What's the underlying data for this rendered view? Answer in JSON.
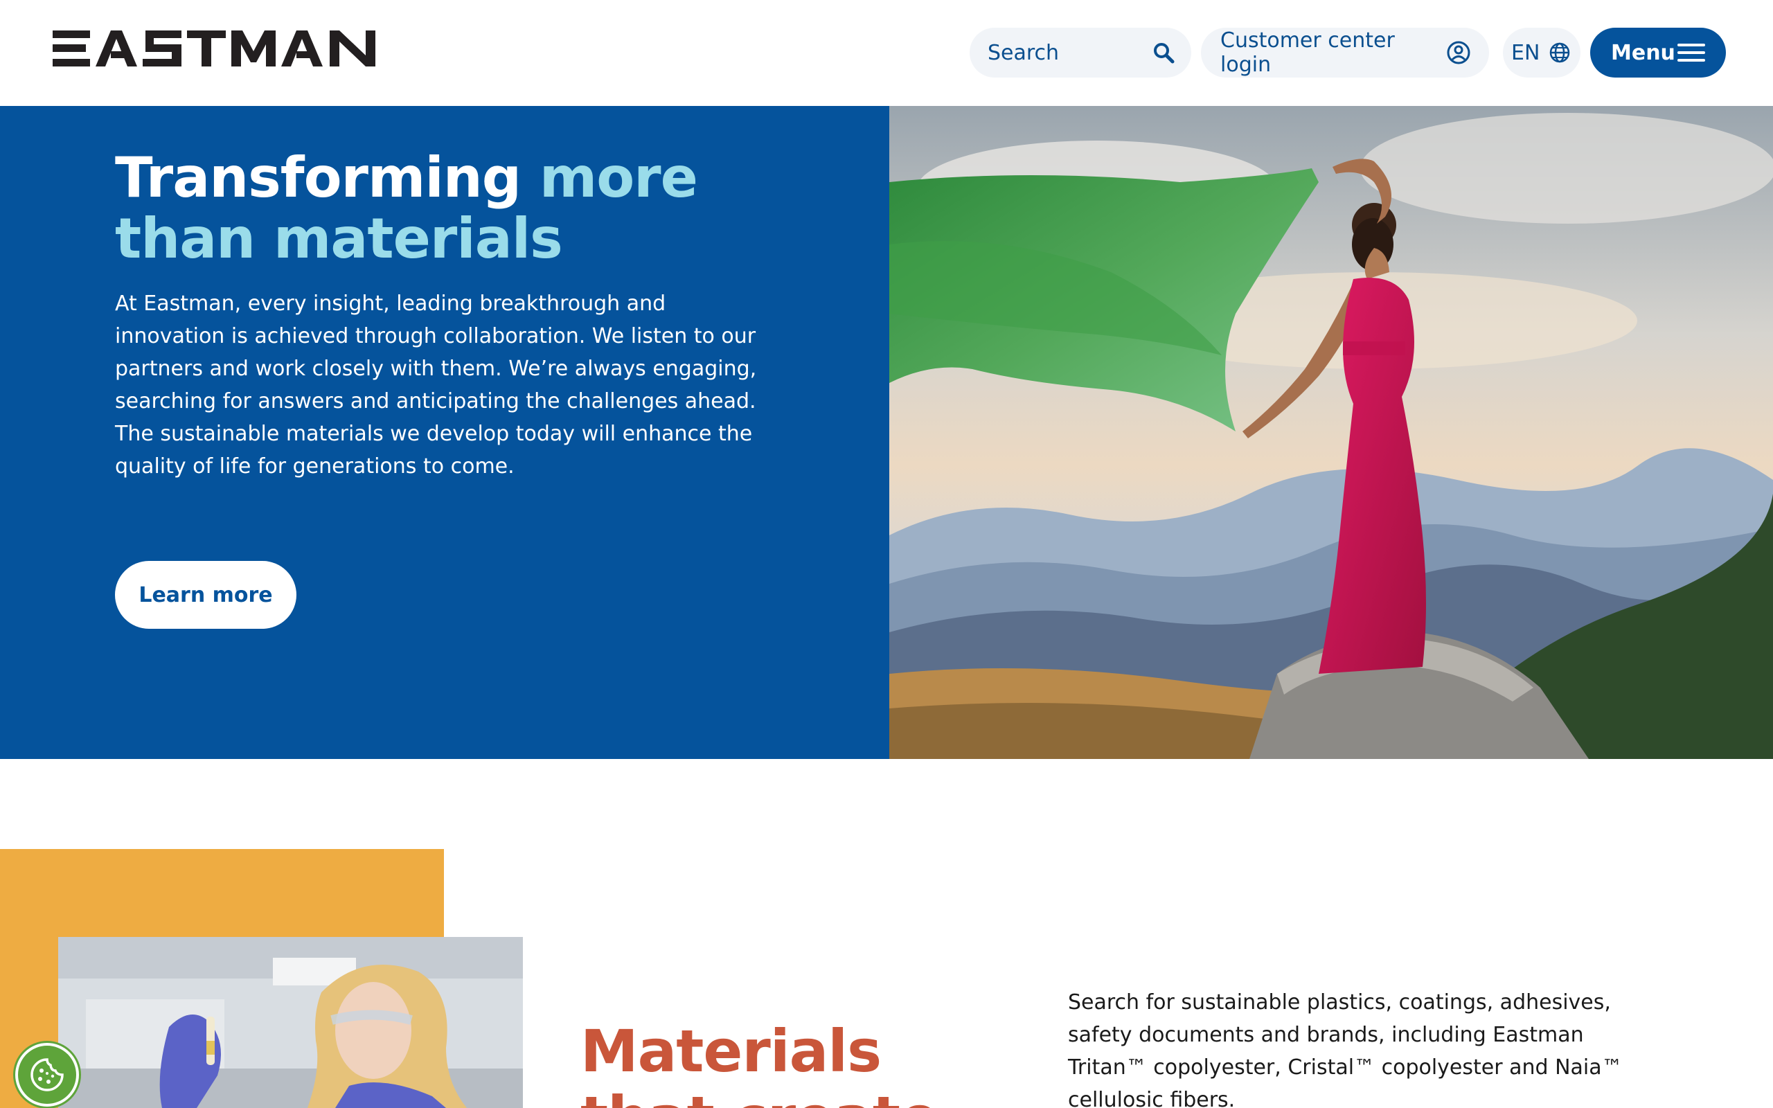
{
  "header": {
    "logo_text": "EASTMAN",
    "search": {
      "placeholder": "Search",
      "icon": "search-icon"
    },
    "login": {
      "label": "Customer center login",
      "icon": "user-circle-icon"
    },
    "language": {
      "label": "EN",
      "icon": "globe-icon"
    },
    "menu": {
      "label": "Menu",
      "icon": "hamburger-icon"
    }
  },
  "hero": {
    "title_white": "Transforming ",
    "title_accent_1": "more",
    "title_accent_2": "than materials",
    "body": "At Eastman, every insight, leading breakthrough and innovation is achieved through collaboration. We listen to our partners and work closely with them. We’re always engaging, searching for answers and anticipating the challenges ahead. The sustainable materials we develop today will enhance the quality of life for generations to come.",
    "cta": "Learn more",
    "image": "woman-in-red-dress-with-green-scarf-on-mountain"
  },
  "materials": {
    "title": "Materials that create",
    "body": "Search for sustainable plastics, coatings, adhesives, safety documents and brands, including Eastman Tritan™ copolyester, Cristal™ copolyester and Naia™ cellulosic fibers.",
    "image": "scientist-in-lab"
  },
  "cookie": {
    "icon": "cookie-icon"
  },
  "colors": {
    "brand_blue": "#05539c",
    "accent_cyan": "#9adcea",
    "orange": "#eeac42",
    "title_red": "#c9563a",
    "cookie_green": "#5ea43a"
  }
}
